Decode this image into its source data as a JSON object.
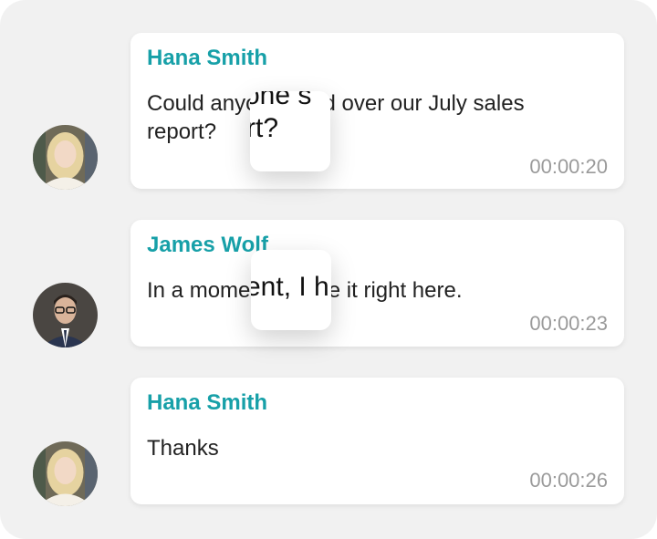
{
  "messages": [
    {
      "sender": "Hana Smith",
      "text": "Could anyone send over our July sales report?",
      "time": "00:00:20",
      "avatar": "female-avatar"
    },
    {
      "sender": "James Wolf",
      "text": "In a moment, I have it right here.",
      "time": "00:00:23",
      "avatar": "male-avatar"
    },
    {
      "sender": "Hana Smith",
      "text": "Thanks",
      "time": "00:00:26",
      "avatar": "female-avatar"
    }
  ],
  "loupes": [
    {
      "line1": "one s",
      "line2": "rt?"
    },
    {
      "line1": "ent, I h"
    }
  ],
  "colors": {
    "accent": "#17a0a8",
    "background": "#f1f1f1",
    "bubble": "#ffffff",
    "timestamp": "#9a9a9a"
  }
}
